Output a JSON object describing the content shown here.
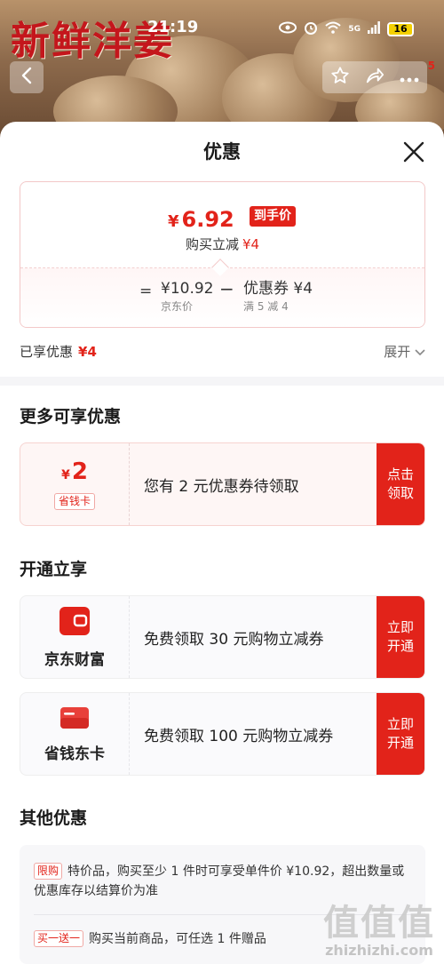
{
  "status_bar": {
    "time": "21:19",
    "network": "5G",
    "battery": "16"
  },
  "hero": {
    "title": "新鲜洋姜",
    "cart_badge": "5"
  },
  "sheet": {
    "title": "优惠",
    "price": {
      "final_currency": "¥",
      "final_value": "6.92",
      "final_tag": "到手价",
      "reduce_label": "购买立减",
      "reduce_value": "¥4",
      "eq": "=",
      "jd_price_value": "¥10.92",
      "jd_price_label": "京东价",
      "minus": "−",
      "coupon_value": "优惠券 ¥4",
      "coupon_label": "满 5 减 4"
    },
    "enjoyed_label": "已享优惠",
    "enjoyed_value": "¥4",
    "expand_label": "展开"
  },
  "more_offers": {
    "title": "更多可享优惠",
    "coupon": {
      "currency": "¥",
      "amount": "2",
      "tag": "省钱卡",
      "text": "您有 2 元优惠券待领取",
      "button": "点击领取"
    }
  },
  "open_enjoy": {
    "title": "开通立享",
    "items": [
      {
        "name": "京东财富",
        "icon": "wallet-icon",
        "text": "免费领取 30 元购物立减券",
        "button": "立即开通"
      },
      {
        "name": "省钱东卡",
        "icon": "card-icon",
        "text": "免费领取 100 元购物立减券",
        "button": "立即开通"
      }
    ]
  },
  "other_offers": {
    "title": "其他优惠",
    "rows": [
      {
        "tag": "限购",
        "text": "特价品，购买至少 1 件时可享受单件价 ¥10.92，超出数量或优惠库存以结算价为准"
      },
      {
        "tag": "买一送一",
        "text": "购买当前商品，可任选 1 件赠品"
      }
    ]
  },
  "watermark": {
    "big": "值值值",
    "small": "zhizhizhi.com"
  },
  "colors": {
    "accent": "#e2231a",
    "card_border": "#f3c8c8"
  }
}
